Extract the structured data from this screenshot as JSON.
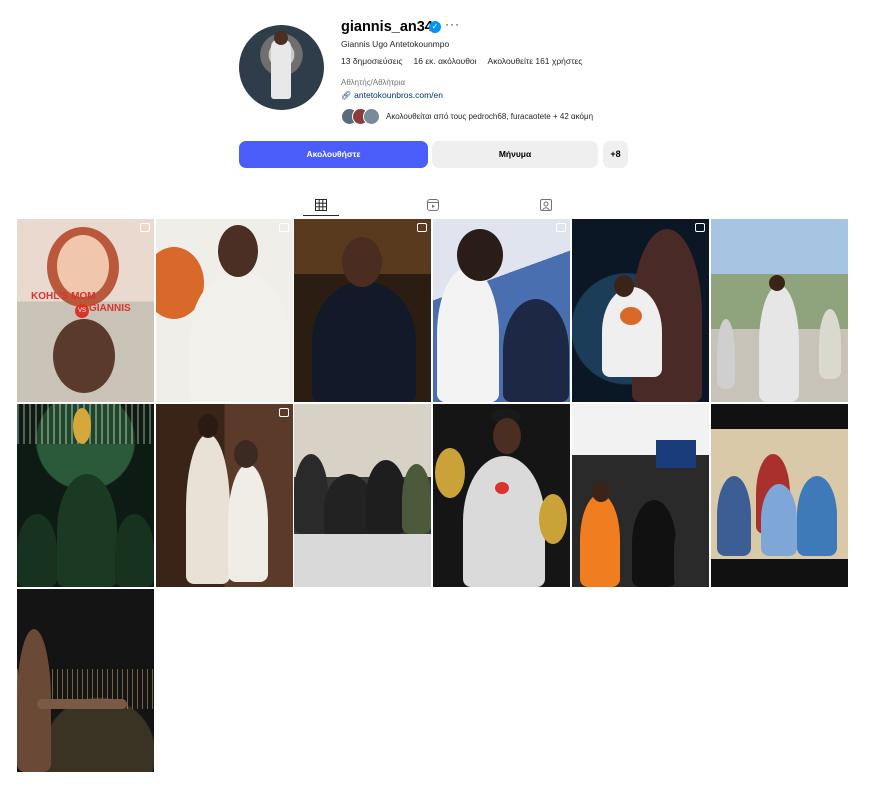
{
  "profile": {
    "username": "giannis_an34",
    "full_name": "Giannis Ugo Antetokounmpo",
    "stats": {
      "posts": "13 δημοσιεύσεις",
      "followers": "16 εκ. ακόλουθοι",
      "following": "Ακολουθείτε 161 χρήστες"
    },
    "category": "Αθλητής/Αθλήτρια",
    "link": "antetokounbros.com/en",
    "followed_by": "Ακολουθείται από τους pedroch68, furacaotete + 42 ακόμη",
    "verified_icon": "verified-badge-icon",
    "more_label": "···"
  },
  "actions": {
    "follow_label": "Ακολουθήστε",
    "message_label": "Μήνυμα",
    "add_user_label": "+8"
  },
  "tabs": [
    {
      "name": "posts",
      "icon": "grid-icon",
      "active": true
    },
    {
      "name": "reels",
      "icon": "reels-icon",
      "active": false
    },
    {
      "name": "tagged",
      "icon": "tagged-icon",
      "active": false
    }
  ],
  "posts_overlay_text": {
    "post_1": "KOHL'S MOM",
    "post_1_vs": "VS",
    "post_1_name": "GIANNIS"
  },
  "colors": {
    "accent": "#4a5df9",
    "verified": "#0095f6",
    "link": "#00376b"
  }
}
